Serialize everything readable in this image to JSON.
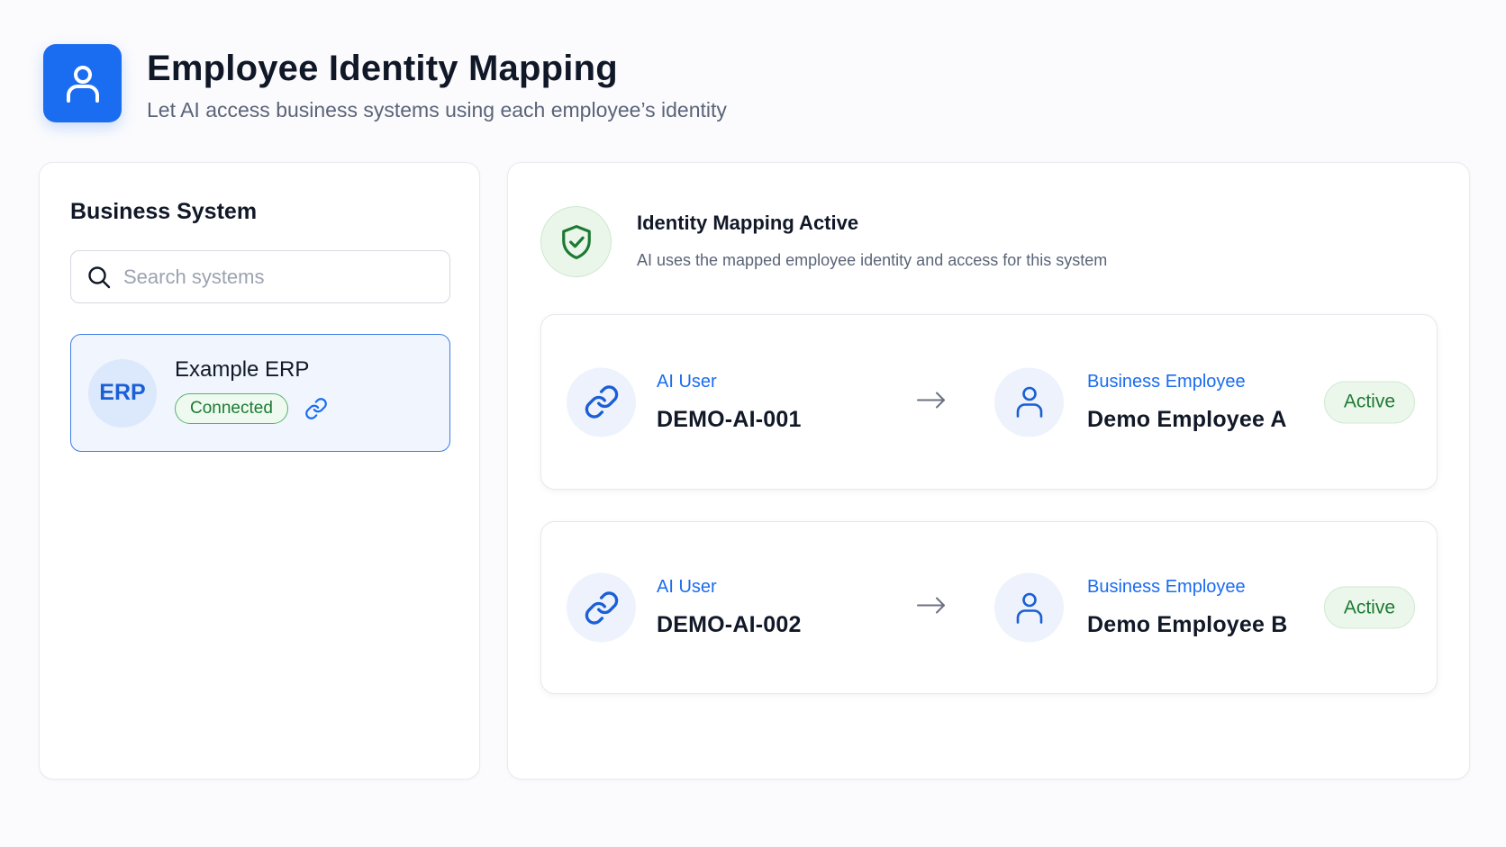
{
  "header": {
    "title": "Employee Identity Mapping",
    "subtitle": "Let AI access business systems using each employee’s identity",
    "icon": "user-icon"
  },
  "business_system_panel": {
    "title": "Business System",
    "search": {
      "placeholder": "Search systems",
      "value": ""
    },
    "systems": [
      {
        "avatar_text": "ERP",
        "name": "Example ERP",
        "status": "Connected",
        "icon": "link-icon",
        "selected": true
      }
    ]
  },
  "mapping_panel": {
    "banner": {
      "title": "Identity Mapping Active",
      "description": "AI uses the mapped employee identity and access for this system",
      "icon": "shield-check-icon"
    },
    "mappings": [
      {
        "ai_label": "AI User",
        "ai_id": "DEMO-AI-001",
        "employee_label": "Business Employee",
        "employee_name": "Demo Employee A",
        "status": "Active"
      },
      {
        "ai_label": "AI User",
        "ai_id": "DEMO-AI-002",
        "employee_label": "Business Employee",
        "employee_name": "Demo Employee B",
        "status": "Active"
      }
    ]
  },
  "colors": {
    "primary": "#1a6cf0",
    "success": "#1d7a33",
    "success_bg": "#ecf7ec",
    "text": "#111827",
    "muted": "#5a6478"
  }
}
